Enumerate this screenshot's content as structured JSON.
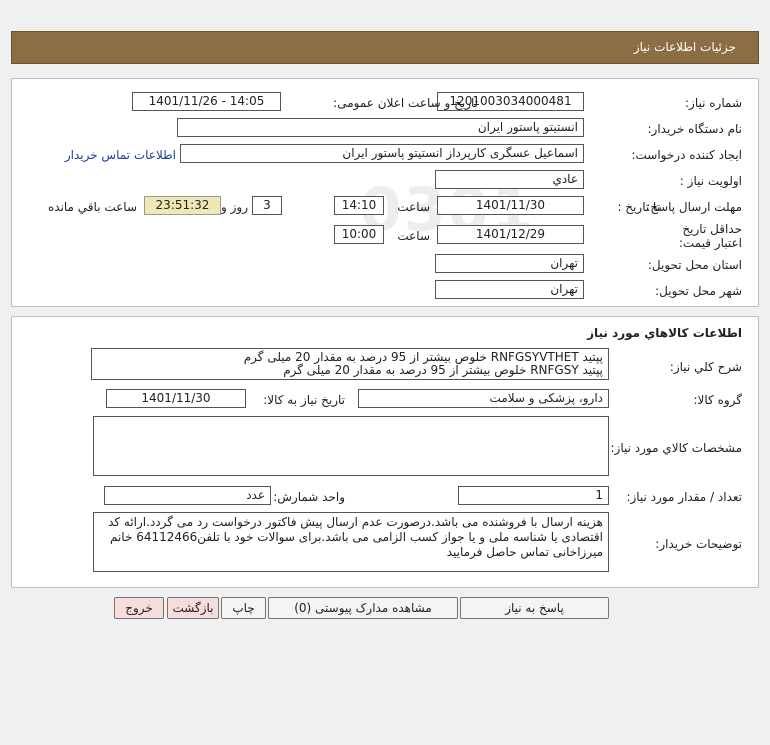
{
  "header": {
    "title": "جزئیات اطلاعات نیاز"
  },
  "form": {
    "need_no_label": "شماره نیاز:",
    "need_no": "1201003034000481",
    "announce_label": "تاریخ و ساعت اعلان عمومی:",
    "announce_value": "1401/11/26 - 14:05",
    "buyer_org_label": "نام دستگاه خریدار:",
    "buyer_org": "انستیتو پاستور ایران",
    "creator_label": "ایجاد کننده درخواست:",
    "creator": "اسماعیل عسگری کارپرداز انستیتو پاستور ایران",
    "contact_link": "اطلاعات تماس خریدار",
    "priority_label": "اولویت نیاز :",
    "priority": "عادي",
    "deadline_label": "مهلت ارسال پاسخ:",
    "to_date_label": "تا تاریخ :",
    "deadline_date": "1401/11/30",
    "time_label": "ساعت",
    "deadline_time": "14:10",
    "days_value": "3",
    "days_label": "روز و",
    "remaining_time": "23:51:32",
    "remaining_label": "ساعت باقي مانده",
    "validity_label": "حداقل تاریخ اعتبار قیمت:",
    "validity_to_label": "تا تاریخ :",
    "validity_date": "1401/12/29",
    "validity_time_label": "ساعت",
    "validity_time": "10:00",
    "province_label": "استان محل تحویل:",
    "province": "تهران",
    "city_label": "شهر محل تحویل:",
    "city": "تهران"
  },
  "goods": {
    "section_title": "اطلاعات کالاهاي مورد نياز",
    "desc_label": "شرح کلي نياز:",
    "desc_line1": "پپتید RNFGSYVTHET خلوص بیشتر از 95 درصد به مقدار 20 میلی گرم",
    "desc_line2": "پپتید RNFGSY خلوص بیشتر از 95 درصد به مقدار 20 میلی گرم",
    "group_label": "گروه کالا:",
    "group": "دارو، پزشکی و سلامت",
    "need_date_label": "تاریخ نیاز به کالا:",
    "need_date": "1401/11/30",
    "specs_label": "مشخصات کالاي مورد نياز:",
    "qty_label": "تعداد / مقدار مورد نیاز:",
    "qty": "1",
    "unit_label": "واحد شمارش:",
    "unit": "عدد",
    "notes_label": "توضیحات خریدار:",
    "notes": "هزینه ارسال با فروشنده می باشد.درصورت عدم ارسال پیش فاکتور درخواست رد می گردد.ارائه کد اقتصادی یا شناسه ملی و یا جواز کسب الزامی می باشد.برای سوالات خود با تلفن64112466 خانم میرزاخانی تماس حاصل فرمایید"
  },
  "buttons": {
    "reply": "پاسخ به نیاز",
    "attachments": "مشاهده مدارک پیوستی (0)",
    "print": "چاپ",
    "back": "بازگشت",
    "exit": "خروج"
  },
  "watermark": {
    "brand": "ParsNamadData",
    "fa1": "مرکز فرآوری اطلاعات پارس نماد داده ها",
    "fa2": "پایگاه اطلاع رسانی مناقصه و مزایده"
  },
  "colors": {
    "header_bg": "#8c6d44",
    "remaining_bg": "#efe8b5",
    "back_bg": "#f7dcdc",
    "exit_bg": "#f7dcdc",
    "link": "#1a3e9a"
  }
}
